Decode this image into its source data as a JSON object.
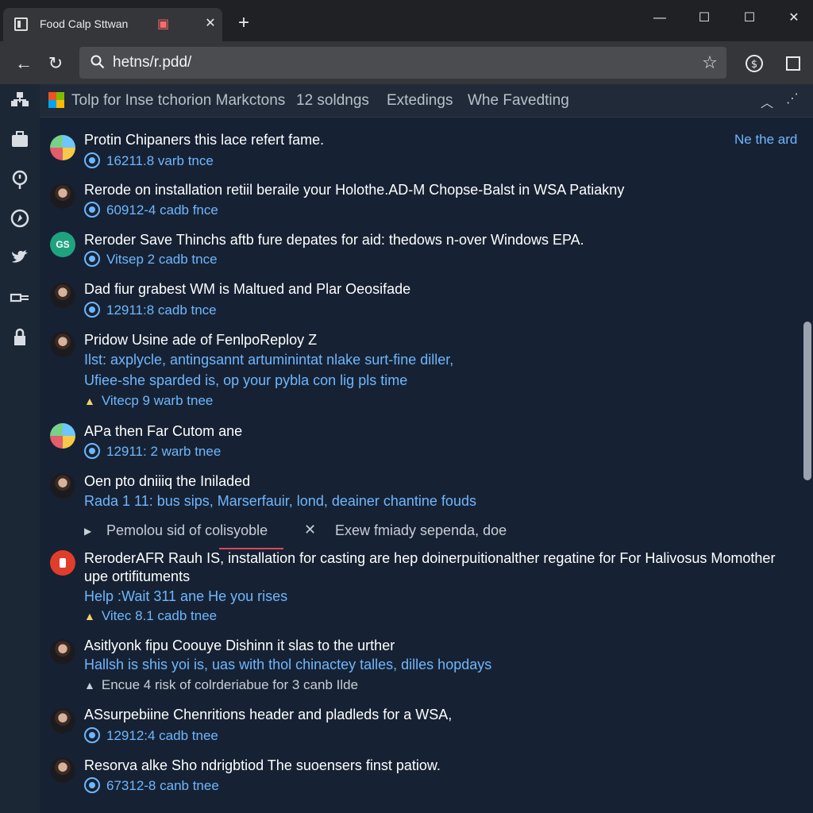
{
  "tab": {
    "title": "Food Calp Sttwan"
  },
  "address_bar": {
    "url": "hetns/r.pdd/"
  },
  "subheader": {
    "items": [
      "Tolp for Inse tchorion Markctons",
      "12 soldngs",
      "Extedings",
      "Whe Favedting"
    ]
  },
  "right_link": "Ne the ard",
  "expander": {
    "left": "Pemolou sid of colisyoble",
    "right": "Exew fmiady sependa, doe"
  },
  "feed": [
    {
      "title": "Protin Chipaners this lace refert fame.",
      "meta": "16211.8  varb tnce"
    },
    {
      "title": "Rerode on installation retiil beraile your Holothe.AD-M Chopse-Balst in WSA Patiakny",
      "meta": "60912-4  cadb fnce"
    },
    {
      "title": "Reroder Save Thinchs aftb fure depates for aid: thedows n-over Windows EPA.",
      "meta": "Vitsep 2  cadb tnce"
    },
    {
      "title": "Dad fiur grabest WM is Maltued and Plar Oeosifade",
      "meta": "12911:8  cadb tnce"
    },
    {
      "title": "Pridow Usine ade of FenlpoReploy Z",
      "line2": "Ilst: axplycle, antingsannt artuminintat nlake surt-fine diller,",
      "line3": "Ufiee-she sparded is, op your pybla con lig pls time",
      "meta": "Vitecp 9  warb tnee"
    },
    {
      "title": "APa then Far Cutom ane",
      "meta": "12911: 2  warb tnee"
    },
    {
      "title": "Oen pto dniiiq the Iniladed",
      "line2": "Rada 1 11: bus sips, Marserfauir, lond, deainer chantine fouds"
    },
    {
      "title": "ReroderAFR Rauh IS, installation for casting are hep doinerpuitionalther regatine for For Halivosus Momother",
      "line2": "upe ortifituments",
      "line3": "Help :Wait 311 ane He you rises",
      "meta": "Vitec 8.1  cadb tnee"
    },
    {
      "title": "Asitlyonk fipu Coouye Dishinn it slas to the urther",
      "line2": "Hallsh is shis yoi is, uas with thol chinactey talles, dilles hopdays",
      "meta": "Encue 4 risk of colrderiabue for 3 canb Ilde"
    },
    {
      "title": "ASsurpebiine Chenritions header and pladleds for a WSA,",
      "meta": "12912:4  cadb tnee"
    },
    {
      "title": "Resorva alke Sho ndrigbtiod The suoensers finst patiow.",
      "meta": "67312-8  canb tnee"
    }
  ],
  "icons": {
    "rail": [
      "network-icon",
      "briefcase-icon",
      "pin-icon",
      "compass-icon",
      "twitter-icon",
      "cable-icon",
      "lock-icon"
    ]
  }
}
